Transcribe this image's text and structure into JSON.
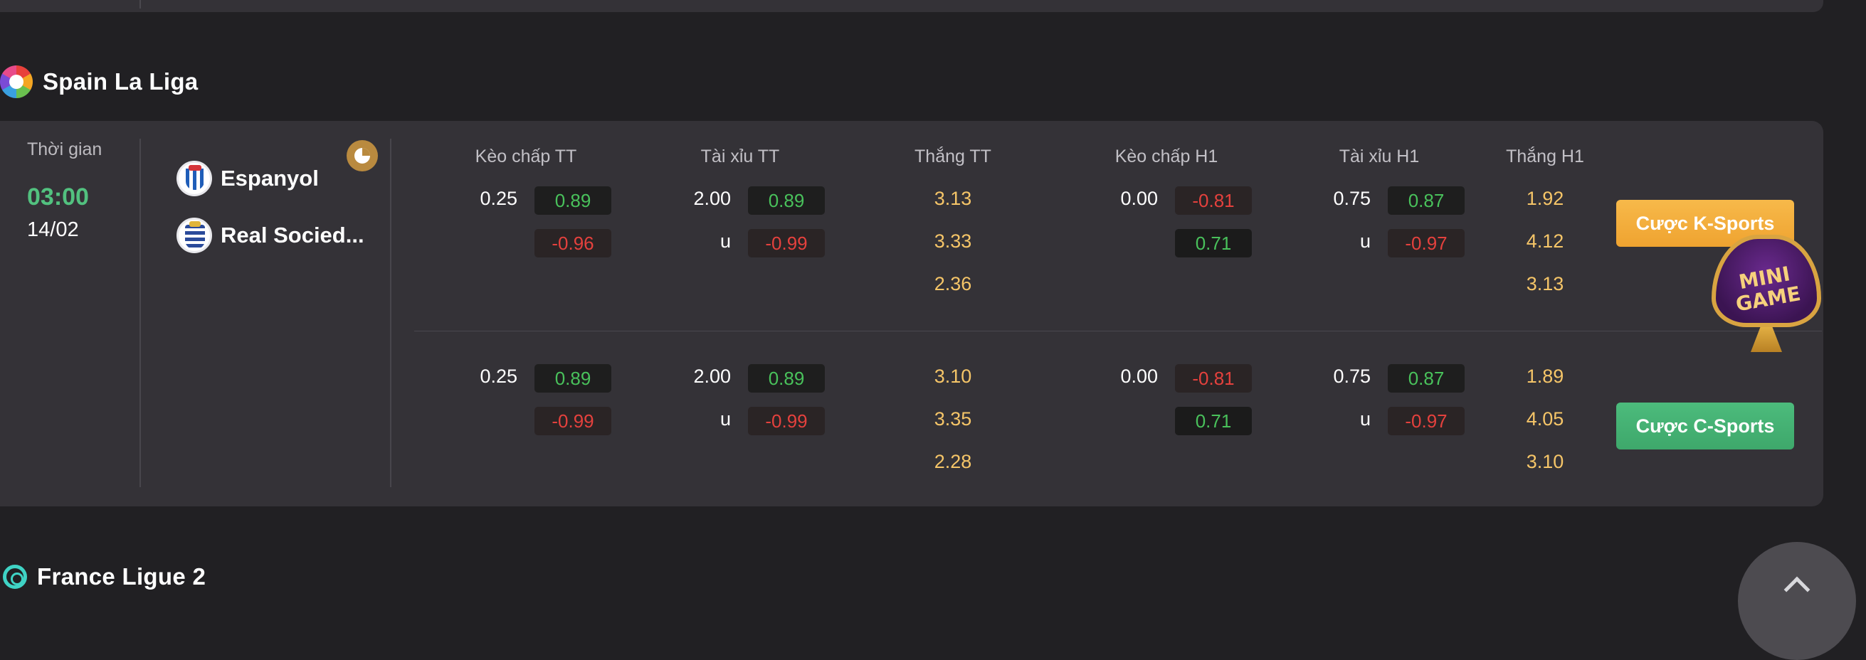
{
  "leagues": {
    "laliga": {
      "name": "Spain La Liga",
      "logo_icon": "laliga-logo-icon"
    },
    "ligue2": {
      "name": "France Ligue 2",
      "logo_icon": "ligue2-logo-icon"
    }
  },
  "match": {
    "time_label": "Thời gian",
    "time": "03:00",
    "date": "14/02",
    "home_team": "Espanyol",
    "away_team": "Real Socied..."
  },
  "columns": [
    "Kèo chấp TT",
    "Tài xỉu TT",
    "Thắng TT",
    "Kèo chấp H1",
    "Tài xỉu H1",
    "Thắng H1"
  ],
  "markets": [
    {
      "handicap_tt": {
        "line": "0.25",
        "home": "0.89",
        "away": "-0.96"
      },
      "ou_tt": {
        "line": "2.00",
        "over": "0.89",
        "under_label": "u",
        "under": "-0.99"
      },
      "win_tt": [
        "3.13",
        "3.33",
        "2.36"
      ],
      "handicap_h1": {
        "line": "0.00",
        "home": "-0.81",
        "away": "0.71"
      },
      "ou_h1": {
        "line": "0.75",
        "over": "0.87",
        "under_label": "u",
        "under": "-0.97"
      },
      "win_h1": [
        "1.92",
        "4.12",
        "3.13"
      ],
      "bet_button": "Cược K-Sports"
    },
    {
      "handicap_tt": {
        "line": "0.25",
        "home": "0.89",
        "away": "-0.99"
      },
      "ou_tt": {
        "line": "2.00",
        "over": "0.89",
        "under_label": "u",
        "under": "-0.99"
      },
      "win_tt": [
        "3.10",
        "3.35",
        "2.28"
      ],
      "handicap_h1": {
        "line": "0.00",
        "home": "-0.81",
        "away": "0.71"
      },
      "ou_h1": {
        "line": "0.75",
        "over": "0.87",
        "under_label": "u",
        "under": "-0.97"
      },
      "win_h1": [
        "1.89",
        "4.05",
        "3.10"
      ],
      "bet_button": "Cược C-Sports"
    }
  ],
  "mini_game": {
    "line1": "MINI",
    "line2": "GAME"
  },
  "colors": {
    "background": "#212023",
    "card": "#343237",
    "accent_green": "#52c17f",
    "odd_positive": "#49c15b",
    "odd_negative": "#e4413d",
    "win_odds": "#f5c568",
    "k_sports_button": "#f2aa38",
    "c_sports_button": "#45b074"
  }
}
